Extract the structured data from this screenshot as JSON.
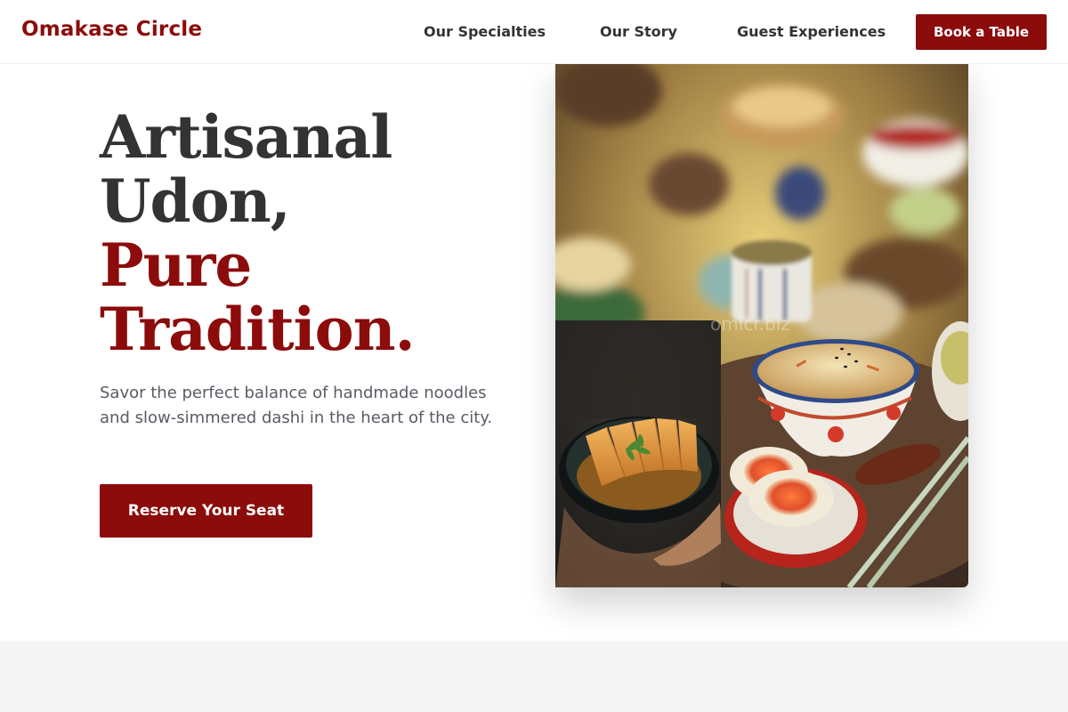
{
  "nav": {
    "brand": "Omakase Circle",
    "links": [
      "Our Specialties",
      "Our Story",
      "Guest Experiences"
    ],
    "cta": "Book a Table"
  },
  "hero": {
    "headline_dark_1": "Artisanal",
    "headline_dark_2": "Udon,",
    "headline_red_1": "Pure",
    "headline_red_2": "Tradition.",
    "lead": "Savor the perfect balance of handmade noodles and slow-simmered dashi in the heart of the city.",
    "cta": "Reserve Your Seat",
    "watermark": "omicr.biz"
  },
  "colors": {
    "accent": "#8c0b0b",
    "headline": "#333333",
    "body_text": "#5a5a66",
    "band": "#f5f5f5"
  }
}
